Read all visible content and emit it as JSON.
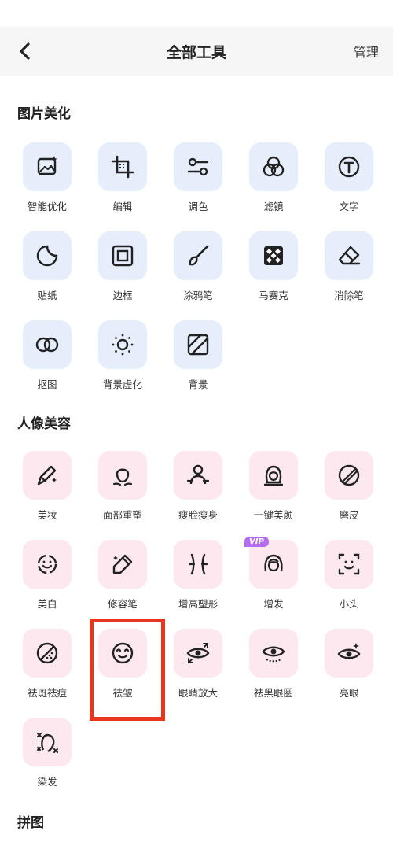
{
  "header": {
    "title": "全部工具",
    "action": "管理"
  },
  "sections": [
    {
      "title": "图片美化"
    },
    {
      "title": "人像美容"
    },
    {
      "title": "拼图"
    }
  ],
  "tools_beauty_photo": [
    {
      "label": "智能优化",
      "icon": "smart-enhance-icon"
    },
    {
      "label": "编辑",
      "icon": "crop-icon"
    },
    {
      "label": "调色",
      "icon": "adjust-sliders-icon"
    },
    {
      "label": "滤镜",
      "icon": "filter-circles-icon"
    },
    {
      "label": "文字",
      "icon": "text-icon"
    },
    {
      "label": "贴纸",
      "icon": "sticker-icon"
    },
    {
      "label": "边框",
      "icon": "frame-icon"
    },
    {
      "label": "涂鸦笔",
      "icon": "brush-icon"
    },
    {
      "label": "马赛克",
      "icon": "mosaic-icon"
    },
    {
      "label": "消除笔",
      "icon": "eraser-icon"
    },
    {
      "label": "抠图",
      "icon": "cutout-icon"
    },
    {
      "label": "背景虚化",
      "icon": "background-blur-icon"
    },
    {
      "label": "背景",
      "icon": "background-icon"
    }
  ],
  "tools_portrait": [
    {
      "label": "美妆",
      "icon": "makeup-icon"
    },
    {
      "label": "面部重塑",
      "icon": "face-reshape-icon"
    },
    {
      "label": "瘦脸瘦身",
      "icon": "slim-body-icon"
    },
    {
      "label": "一键美颜",
      "icon": "one-tap-beauty-icon"
    },
    {
      "label": "磨皮",
      "icon": "smooth-skin-icon"
    },
    {
      "label": "美白",
      "icon": "whiten-icon"
    },
    {
      "label": "修容笔",
      "icon": "contour-pen-icon"
    },
    {
      "label": "增高塑形",
      "icon": "height-shape-icon"
    },
    {
      "label": "增发",
      "icon": "hair-volume-icon",
      "badge": "VIP"
    },
    {
      "label": "小头",
      "icon": "small-head-icon"
    },
    {
      "label": "祛斑祛痘",
      "icon": "spot-removal-icon"
    },
    {
      "label": "祛皱",
      "icon": "wrinkle-removal-icon"
    },
    {
      "label": "眼睛放大",
      "icon": "eye-enlarge-icon"
    },
    {
      "label": "祛黑眼圈",
      "icon": "dark-circle-icon"
    },
    {
      "label": "亮眼",
      "icon": "bright-eye-icon"
    },
    {
      "label": "染发",
      "icon": "hair-dye-icon"
    }
  ],
  "colors": {
    "accent_blue_tile": "#e6eefc",
    "accent_pink_tile": "#fde8f0",
    "highlight": "#e8351e",
    "vip": "#b56cf0"
  }
}
